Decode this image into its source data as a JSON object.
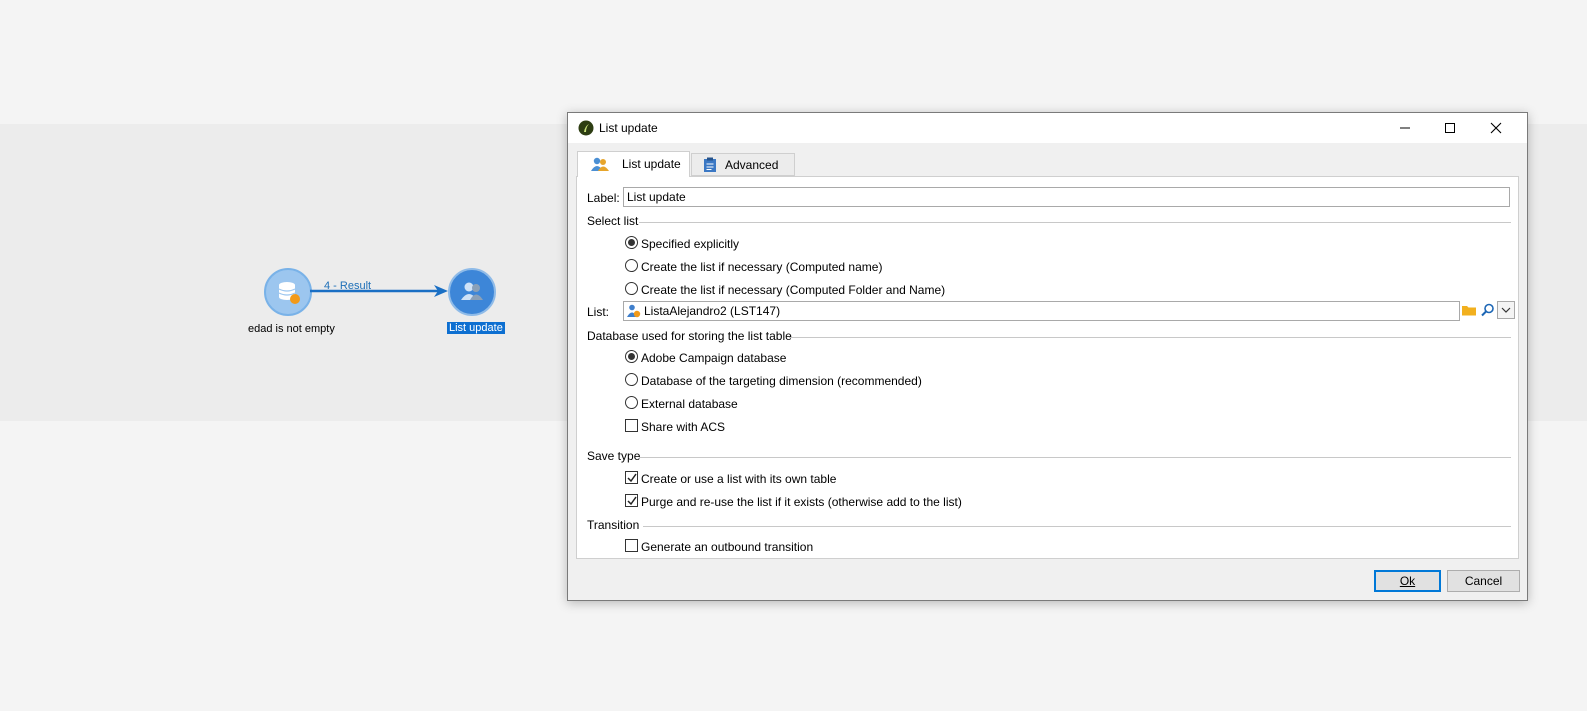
{
  "canvas": {
    "nodes": [
      {
        "label": "edad is not empty",
        "icon": "database-query-icon"
      },
      {
        "label": "List update",
        "icon": "list-update-icon"
      }
    ],
    "transition_label": "4 - Result"
  },
  "dialog": {
    "title": "List update",
    "tabs": [
      {
        "label": "List update",
        "icon": "list-users-icon",
        "active": true
      },
      {
        "label": "Advanced",
        "icon": "clipboard-icon",
        "active": false
      }
    ],
    "label_field": {
      "label": "Label:",
      "value": "List update"
    },
    "select_list": {
      "heading": "Select list",
      "options": [
        {
          "label": "Specified explicitly",
          "selected": true
        },
        {
          "label": "Create the list if necessary (Computed name)",
          "selected": false
        },
        {
          "label": "Create the list if necessary (Computed Folder and Name)",
          "selected": false
        }
      ]
    },
    "list_field": {
      "label": "List:",
      "value": "ListaAlejandro2 (LST147)"
    },
    "database": {
      "heading": "Database used for storing the list table",
      "options": [
        {
          "label": "Adobe Campaign database",
          "selected": true
        },
        {
          "label": "Database of the targeting dimension (recommended)",
          "selected": false
        },
        {
          "label": "External database",
          "selected": false
        }
      ],
      "share_acs": {
        "label": "Share with ACS",
        "checked": false
      }
    },
    "save_type": {
      "heading": "Save type",
      "own_table": {
        "label": "Create or use a list with its own table",
        "checked": true
      },
      "purge": {
        "label": "Purge and re-use the list if it exists (otherwise add to the list)",
        "checked": true
      }
    },
    "transition": {
      "heading": "Transition",
      "outbound": {
        "label": "Generate an outbound transition",
        "checked": false
      }
    },
    "buttons": {
      "ok": "Ok",
      "cancel": "Cancel"
    }
  },
  "colors": {
    "accent": "#0078d7",
    "node_selected": "#0d6fd1",
    "connector": "#1a6fc4"
  }
}
